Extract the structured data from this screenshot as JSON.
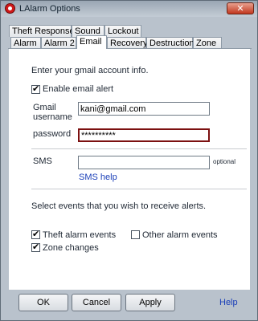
{
  "window": {
    "title": "LAlarm Options",
    "close_glyph": "✕"
  },
  "tabs_back": [
    "Theft Response",
    "Sound",
    "Lockout"
  ],
  "tabs_front": [
    "Alarm",
    "Alarm 2",
    "Email",
    "Recovery",
    "Destruction",
    "Zone"
  ],
  "active_tab": "Email",
  "email": {
    "intro": "Enter your gmail account info.",
    "enable_label": "Enable email alert",
    "enable_checked": true,
    "username_label_1": "Gmail",
    "username_label_2": "username",
    "username_value": "kani@gmail.com",
    "password_label": "password",
    "password_value": "**********",
    "sms_label": "SMS",
    "sms_value": "",
    "sms_optional": "optional",
    "sms_help": "SMS help",
    "events_intro": "Select events that you wish to receive alerts.",
    "events": {
      "theft_label": "Theft alarm events",
      "theft_checked": true,
      "other_label": "Other alarm events",
      "other_checked": false,
      "zone_label": "Zone changes",
      "zone_checked": true
    }
  },
  "buttons": {
    "ok": "OK",
    "cancel": "Cancel",
    "apply": "Apply",
    "help": "Help"
  }
}
